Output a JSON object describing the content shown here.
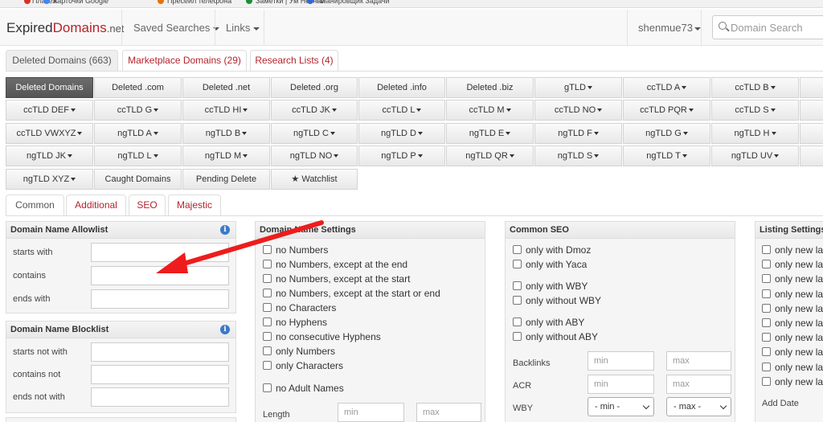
{
  "bookmarks": [
    {
      "label": "Платеж",
      "color": "#d93025"
    },
    {
      "label": "Карточки Google",
      "color": "#4285f4"
    },
    {
      "label": "Пресейл телефона",
      "color": "#e8710a"
    },
    {
      "label": "Заметки | Ум Незнай",
      "color": "#1e8e3e"
    },
    {
      "label": "Планировщик Задачи",
      "color": "#3367d6"
    }
  ],
  "navbar": {
    "brand_main": "Expired",
    "brand_red": "Domains",
    "brand_tld": ".net",
    "saved_searches": "Saved Searches",
    "links": "Links",
    "username": "shenmue73",
    "search_placeholder": "Domain Search"
  },
  "tabs": [
    "Deleted Domains (663)",
    "Marketplace Domains (29)",
    "Research Lists (4)"
  ],
  "grid_rows": [
    [
      "Deleted Domains",
      "Deleted .com",
      "Deleted .net",
      "Deleted .org",
      "Deleted .info",
      "Deleted .biz",
      "gTLD",
      "ccTLD A",
      "ccTLD B"
    ],
    [
      "ccTLD DEF",
      "ccTLD G",
      "ccTLD HI",
      "ccTLD JK",
      "ccTLD L",
      "ccTLD M",
      "ccTLD NO",
      "ccTLD PQR",
      "ccTLD S"
    ],
    [
      "ccTLD VWXYZ",
      "ngTLD A",
      "ngTLD B",
      "ngTLD C",
      "ngTLD D",
      "ngTLD E",
      "ngTLD F",
      "ngTLD G",
      "ngTLD H"
    ],
    [
      "ngTLD JK",
      "ngTLD L",
      "ngTLD M",
      "ngTLD NO",
      "ngTLD P",
      "ngTLD QR",
      "ngTLD S",
      "ngTLD T",
      "ngTLD UV"
    ],
    [
      "ngTLD XYZ",
      "Caught Domains",
      "Pending Delete",
      "★ Watchlist"
    ]
  ],
  "filter_tabs": [
    "Common",
    "Additional",
    "SEO",
    "Majestic"
  ],
  "allowlist": {
    "title": "Domain Name Allowlist",
    "rows": [
      "starts with",
      "contains",
      "ends with"
    ]
  },
  "blocklist": {
    "title": "Domain Name Blocklist",
    "rows": [
      "starts not with",
      "contains not",
      "ends not with"
    ]
  },
  "domain_settings": {
    "title": "Domain Name Settings",
    "options": [
      "no Numbers",
      "no Numbers, except at the end",
      "no Numbers, except at the start",
      "no Numbers, except at the start or end",
      "no Characters",
      "no Hyphens",
      "no consecutive Hyphens",
      "only Numbers",
      "only Characters",
      "no Adult Names"
    ],
    "length_label": "Length",
    "min": "min",
    "max": "max"
  },
  "common_seo": {
    "title": "Common SEO",
    "options": [
      "only with Dmoz",
      "only with Yaca",
      "only with WBY",
      "only without WBY",
      "only with ABY",
      "only without ABY"
    ],
    "backlinks": "Backlinks",
    "acr": "ACR",
    "wby": "WBY",
    "min": "min",
    "max": "max",
    "select_min": "- min -",
    "select_max": "- max -"
  },
  "listing_settings": {
    "title": "Listing Settings",
    "option_text": "only new las",
    "count": 10,
    "add_date": "Add Date"
  },
  "annotation": {
    "arrow_color": "#ee1c1c"
  }
}
